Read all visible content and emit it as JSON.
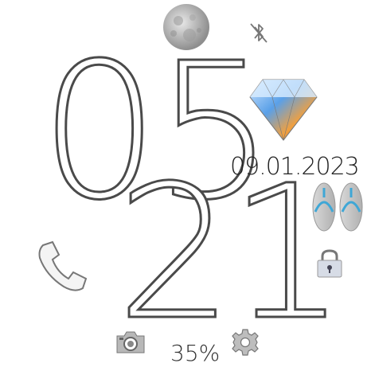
{
  "watchface": {
    "time": {
      "hours": "05",
      "minutes": "21"
    },
    "date": "09.01.2023",
    "battery": "35%",
    "icons": {
      "moon": "moon-phase-icon",
      "bluetooth": "bluetooth-off-icon",
      "diamond": "diamond-icon",
      "steps": "flip-flops-icon",
      "lock": "lock-icon",
      "phone": "phone-icon",
      "camera": "camera-icon",
      "settings": "gear-icon"
    }
  }
}
